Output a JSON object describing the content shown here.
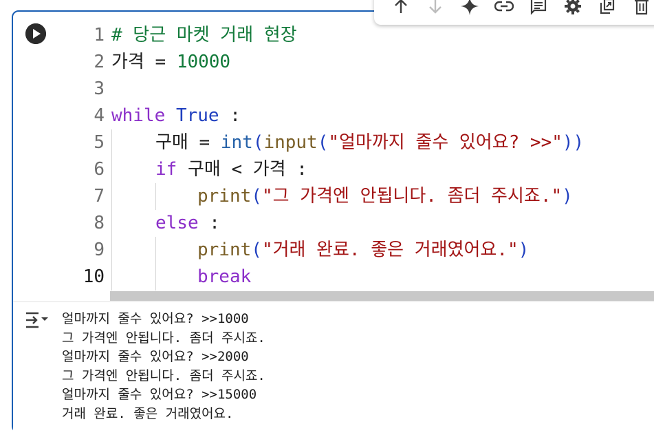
{
  "toolbar": {
    "icons": [
      "arrow-up-icon",
      "arrow-down-icon",
      "sparkle-icon",
      "link-icon",
      "comment-icon",
      "gear-icon",
      "mirror-cell-icon",
      "trash-icon"
    ]
  },
  "editor": {
    "line_numbers": [
      "1",
      "2",
      "3",
      "4",
      "5",
      "6",
      "7",
      "8",
      "9",
      "10"
    ],
    "lines": {
      "l1": {
        "comment": "# 당근 마켓 거래 현장"
      },
      "l2": {
        "var": "가격",
        "op": " = ",
        "num": "10000"
      },
      "l3": {},
      "l4": {
        "kw": "while",
        "sp": " ",
        "bool": "True",
        "rest": " :"
      },
      "l5": {
        "var": "구매",
        "op": " = ",
        "fn1": "int",
        "p1": "(",
        "fn2": "input",
        "p2": "(",
        "str": "\"얼마까지 줄수 있어요? >>\"",
        "p3": ")",
        "p4": ")"
      },
      "l6": {
        "kw": "if",
        "rest": " 구매 < 가격 :"
      },
      "l7": {
        "fn": "print",
        "p1": "(",
        "str": "\"그 가격엔 안됩니다. 좀더 주시죠.\"",
        "p2": ")"
      },
      "l8": {
        "kw": "else",
        "rest": " :"
      },
      "l9": {
        "fn": "print",
        "p1": "(",
        "str": "\"거래 완료. 좋은 거래였어요.\"",
        "p2": ")"
      },
      "l10": {
        "kw": "break"
      }
    }
  },
  "output": {
    "lines": [
      "얼마까지 줄수 있어요? >>1000",
      "그 가격엔 안됩니다. 좀더 주시죠.",
      "얼마까지 줄수 있어요? >>2000",
      "그 가격엔 안됩니다. 좀더 주시죠.",
      "얼마까지 줄수 있어요? >>15000",
      "거래 완료. 좋은 거래였어요."
    ]
  },
  "colors": {
    "cell_border": "#1a5fb4",
    "keyword": "#8b2fc9",
    "boolean": "#1f3fbf",
    "number": "#127a3a",
    "string": "#a31515",
    "function": "#795e26",
    "comment": "#127a3a"
  }
}
